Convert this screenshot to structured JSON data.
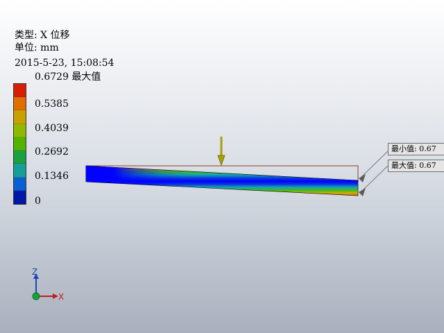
{
  "result": {
    "type_label": "类型: X 位移",
    "unit_label": "单位: mm",
    "timestamp": "2015-5-23, 15:08:54"
  },
  "legend": {
    "max_label": "0.6729 最大值",
    "labels": [
      "0.5385",
      "0.4039",
      "0.2692",
      "0.1346",
      "0"
    ],
    "colors": [
      "#d61f00",
      "#e06e00",
      "#c8a100",
      "#90b800",
      "#53b400",
      "#1c9f3f",
      "#179d9a",
      "#0b5fd0",
      "#0018a8"
    ]
  },
  "annotations": {
    "min_value_label": "最小值: 0.67",
    "max_value_label": "最大值: 0.67"
  },
  "axes": {
    "z_label": "Z",
    "x_label": "X"
  },
  "colors": {
    "load_arrow": "#a89f00",
    "outline": "#8b3f1f",
    "triad_z": "#1f44b5",
    "triad_x": "#c01e1e",
    "triad_origin": "#18a33a"
  }
}
